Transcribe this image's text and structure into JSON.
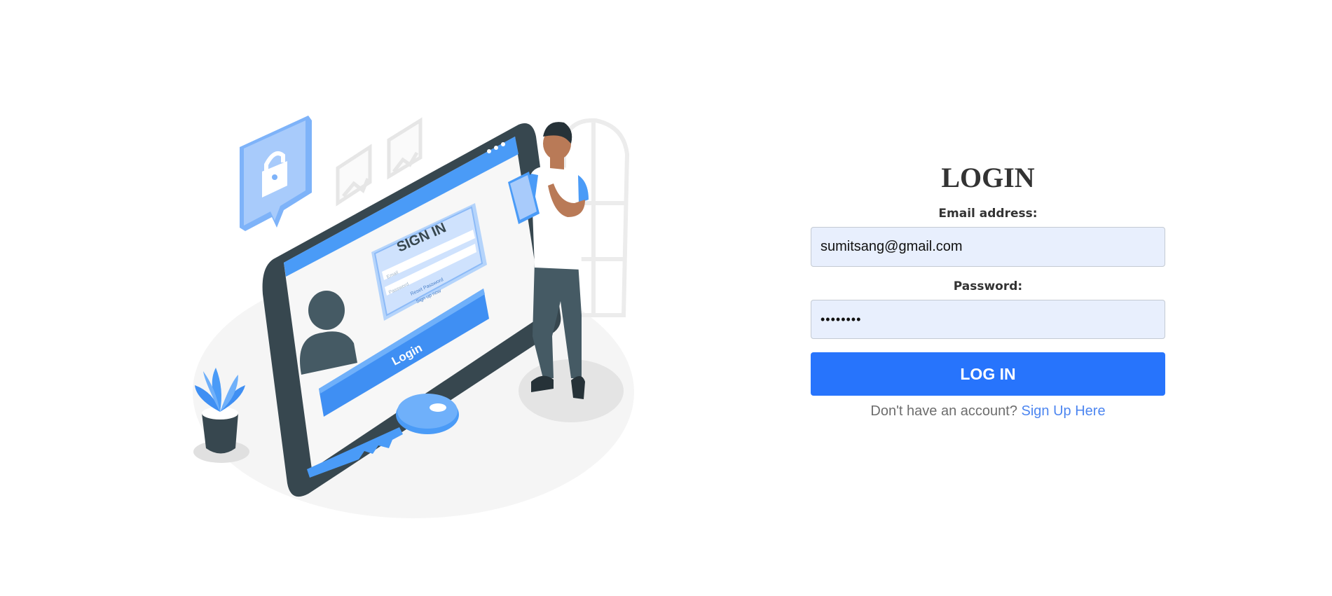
{
  "illustration": {
    "screen_title": "SIGN IN",
    "screen_email_placeholder": "Email",
    "screen_password_placeholder": "Password",
    "screen_reset_link": "Reset Password",
    "screen_signup_link": "Sign up now",
    "screen_login_button": "Login",
    "colors": {
      "accent": "#4a9bf7",
      "accent_light": "#a9cdfa",
      "dark": "#37474f"
    }
  },
  "form": {
    "title": "LOGIN",
    "email_label": "Email address:",
    "email_value": "sumitsang@gmail.com",
    "password_label": "Password:",
    "password_value": "password",
    "login_button_label": "LOG IN",
    "signup_prompt": "Don't have an account?",
    "signup_link_label": "Sign Up Here"
  },
  "colors": {
    "button": "#2774fc",
    "input_bg": "#e8effd",
    "link": "#4d86f0",
    "title": "#333333"
  }
}
